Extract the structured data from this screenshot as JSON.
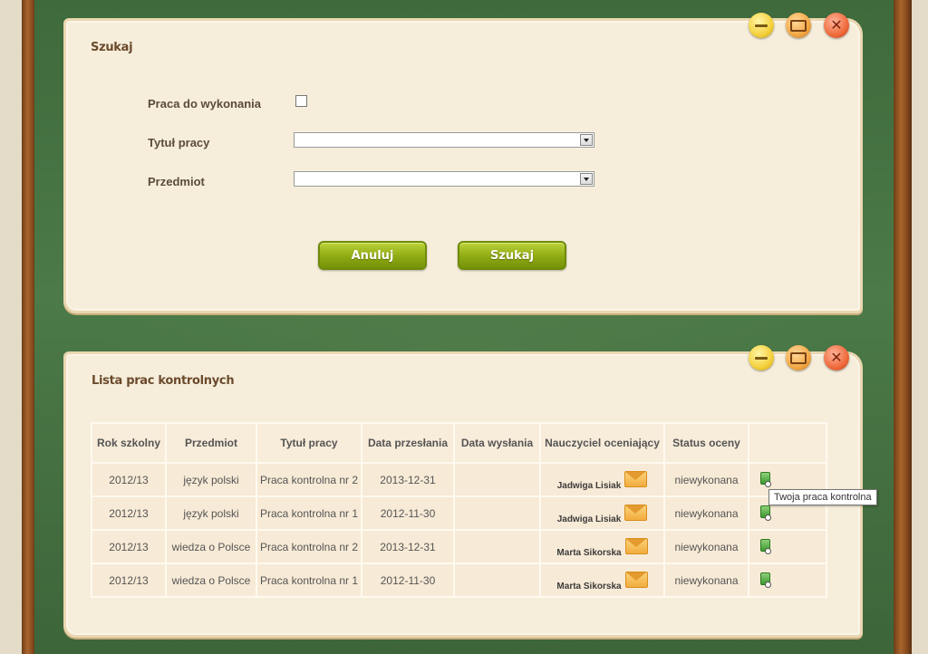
{
  "search_panel": {
    "title": "Szukaj",
    "fields": {
      "praca_label": "Praca do wykonania",
      "praca_checked": false,
      "tytul_label": "Tytuł pracy",
      "tytul_value": "",
      "przedmiot_label": "Przedmiot",
      "przedmiot_value": ""
    },
    "buttons": {
      "cancel": "Anuluj",
      "search": "Szukaj"
    }
  },
  "list_panel": {
    "title": "Lista prac kontrolnych",
    "columns": [
      "Rok szkolny",
      "Przedmiot",
      "Tytuł pracy",
      "Data przesłania",
      "Data wysłania",
      "Nauczyciel oceniający",
      "Status oceny",
      ""
    ],
    "rows": [
      {
        "rok": "2012/13",
        "przedmiot": "język polski",
        "tytul": "Praca kontrolna nr 2",
        "data_przeslania": "2013-12-31",
        "data_wyslania": "",
        "nauczyciel": "Jadwiga Lisiak",
        "status": "niewykonana"
      },
      {
        "rok": "2012/13",
        "przedmiot": "język polski",
        "tytul": "Praca kontrolna nr 1",
        "data_przeslania": "2012-11-30",
        "data_wyslania": "",
        "nauczyciel": "Jadwiga Lisiak",
        "status": "niewykonana"
      },
      {
        "rok": "2012/13",
        "przedmiot": "wiedza o Polsce",
        "tytul": "Praca kontrolna nr 2",
        "data_przeslania": "2013-12-31",
        "data_wyslania": "",
        "nauczyciel": "Marta Sikorska",
        "status": "niewykonana"
      },
      {
        "rok": "2012/13",
        "przedmiot": "wiedza o Polsce",
        "tytul": "Praca kontrolna nr 1",
        "data_przeslania": "2012-11-30",
        "data_wyslania": "",
        "nauczyciel": "Marta Sikorska",
        "status": "niewykonana"
      }
    ]
  },
  "tooltip": "Twoja praca kontrolna",
  "icons": {
    "minimize": "minimize-icon",
    "maximize": "maximize-icon",
    "close": "close-icon",
    "message": "envelope-icon",
    "document": "document-icon"
  },
  "colors": {
    "board": "#4c7a48",
    "panel": "#f6eedb",
    "button_green": "#8eaa12",
    "minimize": "#f4d03c",
    "maximize": "#f2a846",
    "close": "#ef6b3c"
  }
}
